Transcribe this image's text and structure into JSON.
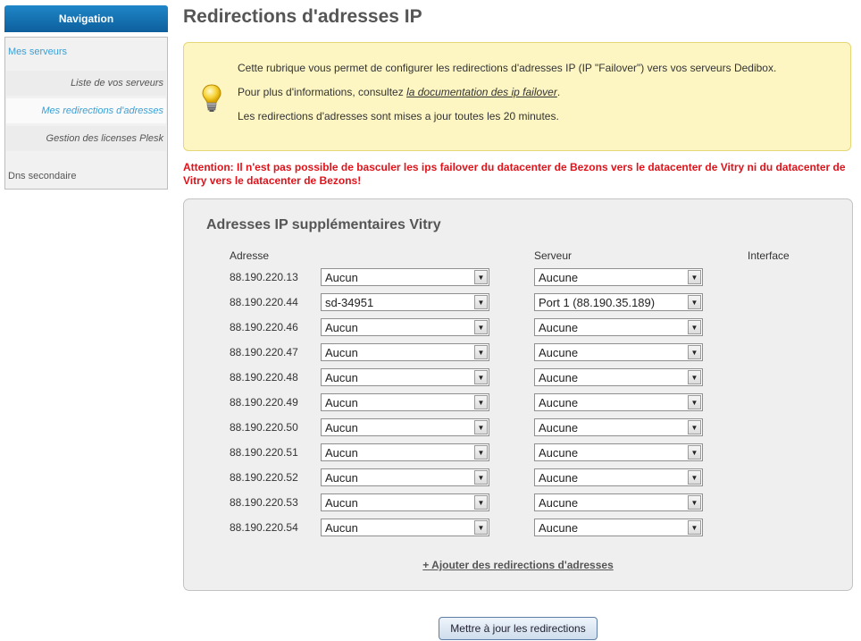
{
  "sidebar": {
    "header": "Navigation",
    "section_servers": "Mes serveurs",
    "items": [
      {
        "label": "Liste de vos serveurs",
        "active": false
      },
      {
        "label": "Mes redirections d'adresses",
        "active": true
      },
      {
        "label": "Gestion des licenses Plesk",
        "active": false
      }
    ],
    "section_dns": "Dns secondaire"
  },
  "main": {
    "title": "Redirections d'adresses IP",
    "info": {
      "line1": "Cette rubrique vous permet de configurer les redirections d'adresses IP (IP \"Failover\") vers vos serveurs Dedibox.",
      "line2_prefix": "Pour plus d'informations, consultez ",
      "line2_link": "la documentation des ip failover",
      "line2_suffix": ".",
      "line3": "Les redirections d'adresses sont mises a jour toutes les 20 minutes."
    },
    "warning": "Attention: Il n'est pas possible de basculer les ips failover du datacenter de Bezons vers le datacenter de Vitry ni du datacenter de Vitry vers le datacenter de Bezons!",
    "panel": {
      "title": "Adresses IP supplémentaires Vitry",
      "columns": {
        "address": "Adresse",
        "server": "Serveur",
        "interface": "Interface"
      },
      "rows": [
        {
          "ip": "88.190.220.13",
          "server": "Aucun",
          "port": "Aucune"
        },
        {
          "ip": "88.190.220.44",
          "server": "sd-34951",
          "port": "Port 1 (88.190.35.189)"
        },
        {
          "ip": "88.190.220.46",
          "server": "Aucun",
          "port": "Aucune"
        },
        {
          "ip": "88.190.220.47",
          "server": "Aucun",
          "port": "Aucune"
        },
        {
          "ip": "88.190.220.48",
          "server": "Aucun",
          "port": "Aucune"
        },
        {
          "ip": "88.190.220.49",
          "server": "Aucun",
          "port": "Aucune"
        },
        {
          "ip": "88.190.220.50",
          "server": "Aucun",
          "port": "Aucune"
        },
        {
          "ip": "88.190.220.51",
          "server": "Aucun",
          "port": "Aucune"
        },
        {
          "ip": "88.190.220.52",
          "server": "Aucun",
          "port": "Aucune"
        },
        {
          "ip": "88.190.220.53",
          "server": "Aucun",
          "port": "Aucune"
        },
        {
          "ip": "88.190.220.54",
          "server": "Aucun",
          "port": "Aucune"
        }
      ],
      "add_link": "+ Ajouter des redirections d'adresses"
    },
    "update_button": "Mettre à jour les redirections"
  },
  "icons": {
    "info": "lightbulb-icon",
    "dropdown": "chevron-down-icon"
  },
  "colors": {
    "nav_header": "#0d5f9c",
    "link_active": "#3aa0d6",
    "warning": "#e0131b",
    "info_bg": "#fdf6c3"
  }
}
